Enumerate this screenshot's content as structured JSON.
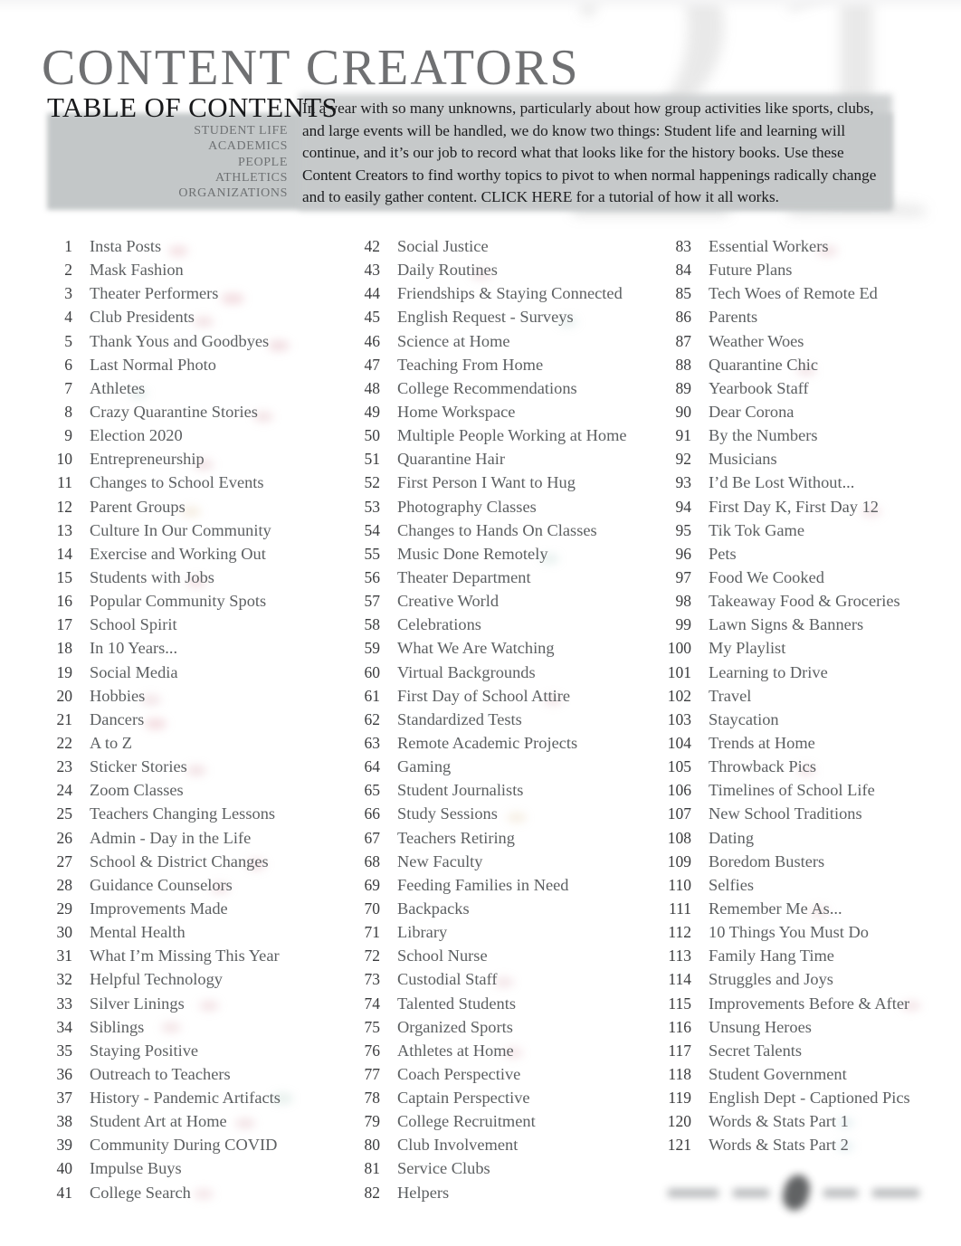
{
  "document": {
    "main_title": "CONTENT CREATORS",
    "section_title": "TABLE OF CONTENTS",
    "watermark": "21",
    "intro_paragraph": "In a year with so many unknowns, particularly about how group activities like sports, clubs, and large events will be handled, we do know two things: Student life and learning will continue, and it’s our job to record what that looks like for the history books. Use these Content Creators to find worthy topics to pivot to when normal happenings radically change and to easily gather content. CLICK HERE for a tutorial of how it all works.",
    "colors": {
      "main_title": "#6f7072",
      "section_title": "#17181a",
      "band": "#c3c7c8",
      "entry_number": "#3a3b3d",
      "entry_label": "#5d6062",
      "category": "#6e7173"
    }
  },
  "categories": [
    "STUDENT LIFE",
    "ACADEMICS",
    "PEOPLE",
    "ATHLETICS",
    "ORGANIZATIONS"
  ],
  "columns": [
    {
      "name": "column-1",
      "entries": [
        {
          "number": "1",
          "label": "Insta Posts"
        },
        {
          "number": "2",
          "label": "Mask Fashion"
        },
        {
          "number": "3",
          "label": "Theater Performers"
        },
        {
          "number": "4",
          "label": "Club Presidents"
        },
        {
          "number": "5",
          "label": "Thank Yous and Goodbyes"
        },
        {
          "number": "6",
          "label": "Last Normal Photo"
        },
        {
          "number": "7",
          "label": "Athletes"
        },
        {
          "number": "8",
          "label": "Crazy Quarantine Stories"
        },
        {
          "number": "9",
          "label": "Election 2020"
        },
        {
          "number": "10",
          "label": "Entrepreneurship"
        },
        {
          "number": "11",
          "label": "Changes to School Events"
        },
        {
          "number": "12",
          "label": "Parent Groups"
        },
        {
          "number": "13",
          "label": "Culture In Our Community"
        },
        {
          "number": "14",
          "label": "Exercise and Working Out"
        },
        {
          "number": "15",
          "label": "Students with Jobs"
        },
        {
          "number": "16",
          "label": "Popular Community Spots"
        },
        {
          "number": "17",
          "label": "School Spirit"
        },
        {
          "number": "18",
          "label": "In 10 Years..."
        },
        {
          "number": "19",
          "label": "Social Media"
        },
        {
          "number": "20",
          "label": "Hobbies"
        },
        {
          "number": "21",
          "label": "Dancers"
        },
        {
          "number": "22",
          "label": "A to Z"
        },
        {
          "number": "23",
          "label": "Sticker Stories"
        },
        {
          "number": "24",
          "label": "Zoom Classes"
        },
        {
          "number": "25",
          "label": "Teachers Changing Lessons"
        },
        {
          "number": "26",
          "label": "Admin - Day in the Life"
        },
        {
          "number": "27",
          "label": "School & District Changes"
        },
        {
          "number": "28",
          "label": "Guidance Counselors"
        },
        {
          "number": "29",
          "label": "Improvements Made"
        },
        {
          "number": "30",
          "label": "Mental Health"
        },
        {
          "number": "31",
          "label": "What I’m Missing This Year"
        },
        {
          "number": "32",
          "label": "Helpful Technology"
        },
        {
          "number": "33",
          "label": "Silver Linings"
        },
        {
          "number": "34",
          "label": "Siblings"
        },
        {
          "number": "35",
          "label": "Staying Positive"
        },
        {
          "number": "36",
          "label": "Outreach to Teachers"
        },
        {
          "number": "37",
          "label": "History - Pandemic Artifacts"
        },
        {
          "number": "38",
          "label": "Student Art at Home"
        },
        {
          "number": "39",
          "label": "Community During COVID"
        },
        {
          "number": "40",
          "label": "Impulse Buys"
        },
        {
          "number": "41",
          "label": "College Search"
        }
      ]
    },
    {
      "name": "column-2",
      "entries": [
        {
          "number": "42",
          "label": "Social Justice"
        },
        {
          "number": "43",
          "label": "Daily Routines"
        },
        {
          "number": "44",
          "label": "Friendships & Staying Connected"
        },
        {
          "number": "45",
          "label": "English Request - Surveys"
        },
        {
          "number": "46",
          "label": "Science at Home"
        },
        {
          "number": "47",
          "label": "Teaching From Home"
        },
        {
          "number": "48",
          "label": "College Recommendations"
        },
        {
          "number": "49",
          "label": "Home Workspace"
        },
        {
          "number": "50",
          "label": "Multiple People Working at Home"
        },
        {
          "number": "51",
          "label": "Quarantine Hair"
        },
        {
          "number": "52",
          "label": "First Person I Want to Hug"
        },
        {
          "number": "53",
          "label": "Photography Classes"
        },
        {
          "number": "54",
          "label": "Changes to Hands On Classes"
        },
        {
          "number": "55",
          "label": "Music Done Remotely"
        },
        {
          "number": "56",
          "label": "Theater Department"
        },
        {
          "number": "57",
          "label": "Creative World"
        },
        {
          "number": "58",
          "label": "Celebrations"
        },
        {
          "number": "59",
          "label": "What We Are Watching"
        },
        {
          "number": "60",
          "label": "Virtual Backgrounds"
        },
        {
          "number": "61",
          "label": "First Day of School Attire"
        },
        {
          "number": "62",
          "label": "Standardized Tests"
        },
        {
          "number": "63",
          "label": "Remote Academic Projects"
        },
        {
          "number": "64",
          "label": "Gaming"
        },
        {
          "number": "65",
          "label": "Student Journalists"
        },
        {
          "number": "66",
          "label": "Study Sessions"
        },
        {
          "number": "67",
          "label": "Teachers Retiring"
        },
        {
          "number": "68",
          "label": "New Faculty"
        },
        {
          "number": "69",
          "label": "Feeding Families in Need"
        },
        {
          "number": "70",
          "label": "Backpacks"
        },
        {
          "number": "71",
          "label": "Library"
        },
        {
          "number": "72",
          "label": "School Nurse"
        },
        {
          "number": "73",
          "label": "Custodial Staff"
        },
        {
          "number": "74",
          "label": "Talented Students"
        },
        {
          "number": "75",
          "label": "Organized Sports"
        },
        {
          "number": "76",
          "label": "Athletes at Home"
        },
        {
          "number": "77",
          "label": "Coach Perspective"
        },
        {
          "number": "78",
          "label": "Captain Perspective"
        },
        {
          "number": "79",
          "label": "College Recruitment"
        },
        {
          "number": "80",
          "label": "Club Involvement"
        },
        {
          "number": "81",
          "label": "Service Clubs"
        },
        {
          "number": "82",
          "label": "Helpers"
        }
      ]
    },
    {
      "name": "column-3",
      "entries": [
        {
          "number": "83",
          "label": "Essential Workers"
        },
        {
          "number": "84",
          "label": "Future Plans"
        },
        {
          "number": "85",
          "label": "Tech Woes of Remote Ed"
        },
        {
          "number": "86",
          "label": "Parents"
        },
        {
          "number": "87",
          "label": "Weather Woes"
        },
        {
          "number": "88",
          "label": "Quarantine Chic"
        },
        {
          "number": "89",
          "label": "Yearbook Staff"
        },
        {
          "number": "90",
          "label": "Dear Corona"
        },
        {
          "number": "91",
          "label": "By the Numbers"
        },
        {
          "number": "92",
          "label": "Musicians"
        },
        {
          "number": "93",
          "label": "I’d Be Lost Without..."
        },
        {
          "number": "94",
          "label": "First Day K, First Day 12"
        },
        {
          "number": "95",
          "label": "Tik Tok Game"
        },
        {
          "number": "96",
          "label": "Pets"
        },
        {
          "number": "97",
          "label": "Food We Cooked"
        },
        {
          "number": "98",
          "label": "Takeaway Food & Groceries"
        },
        {
          "number": "99",
          "label": "Lawn Signs & Banners"
        },
        {
          "number": "100",
          "label": "My Playlist"
        },
        {
          "number": "101",
          "label": "Learning to Drive"
        },
        {
          "number": "102",
          "label": "Travel"
        },
        {
          "number": "103",
          "label": "Staycation"
        },
        {
          "number": "104",
          "label": "Trends at Home"
        },
        {
          "number": "105",
          "label": "Throwback Pics"
        },
        {
          "number": "106",
          "label": "Timelines of School Life"
        },
        {
          "number": "107",
          "label": "New School Traditions"
        },
        {
          "number": "108",
          "label": "Dating"
        },
        {
          "number": "109",
          "label": "Boredom Busters"
        },
        {
          "number": "110",
          "label": "Selfies"
        },
        {
          "number": "111",
          "label": "Remember Me As..."
        },
        {
          "number": "112",
          "label": "10 Things You Must Do"
        },
        {
          "number": "113",
          "label": "Family Hang Time"
        },
        {
          "number": "114",
          "label": "Struggles and Joys"
        },
        {
          "number": "115",
          "label": "Improvements Before & After"
        },
        {
          "number": "116",
          "label": "Unsung Heroes"
        },
        {
          "number": "117",
          "label": "Secret Talents"
        },
        {
          "number": "118",
          "label": "Student Government"
        },
        {
          "number": "119",
          "label": "English Dept - Captioned Pics"
        },
        {
          "number": "120",
          "label": "Words & Stats Part 1"
        },
        {
          "number": "121",
          "label": "Words & Stats Part 2"
        }
      ]
    }
  ]
}
